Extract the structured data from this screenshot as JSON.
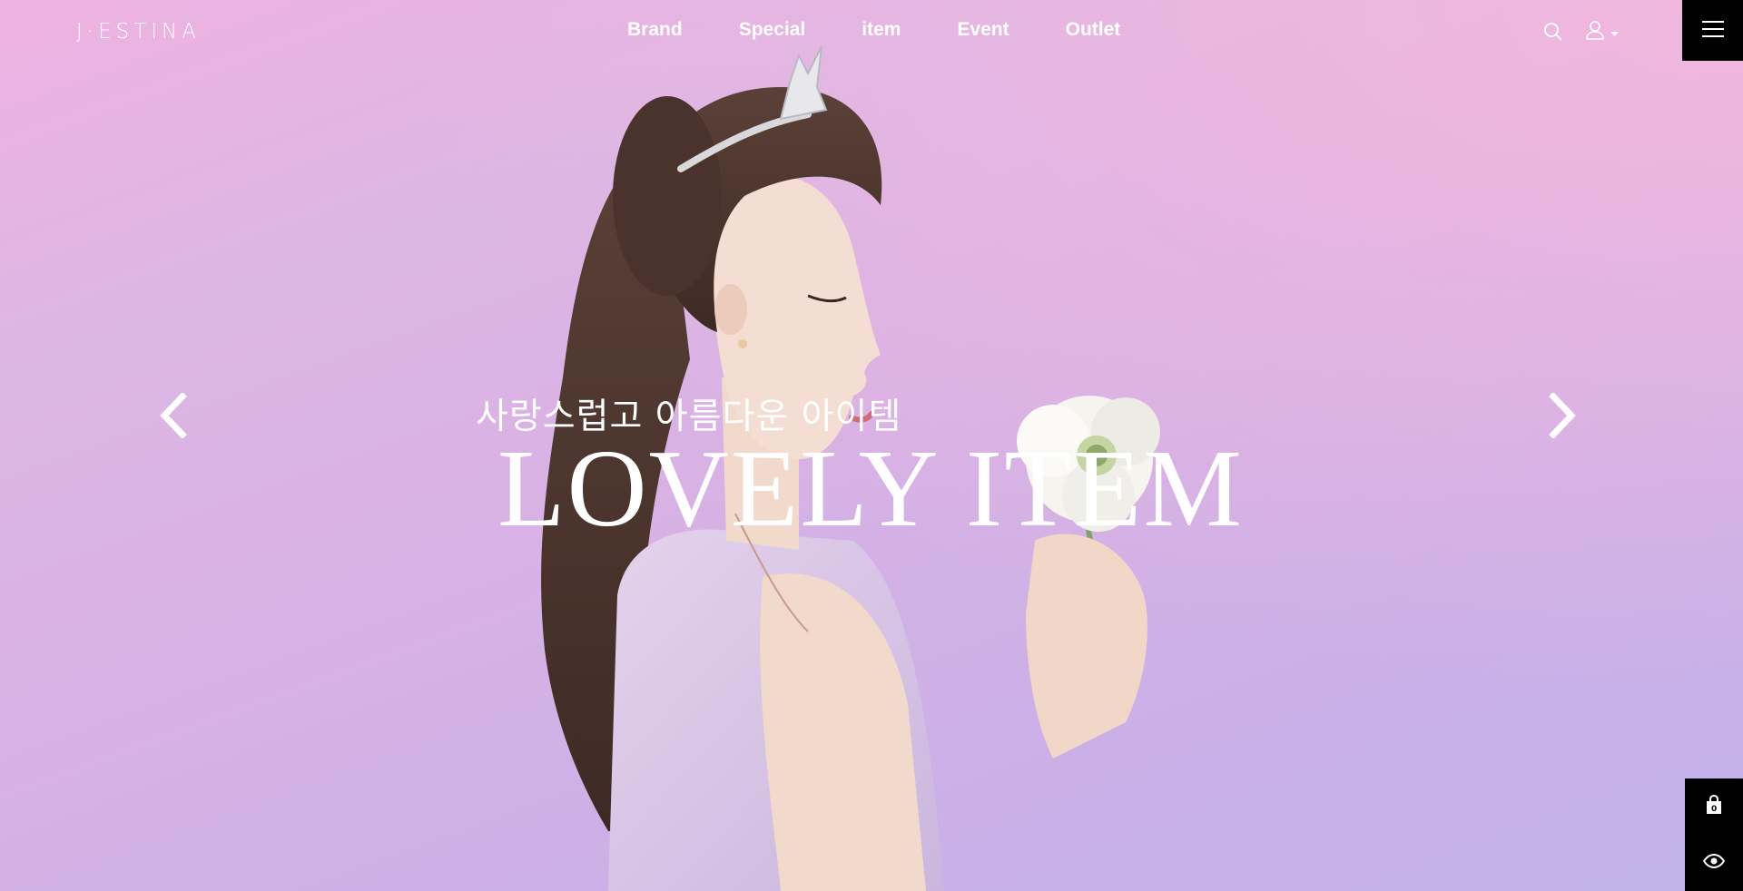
{
  "header": {
    "logo": "J·ESTINA",
    "nav": [
      "Brand",
      "Special",
      "item",
      "Event",
      "Outlet"
    ],
    "icons": [
      "search-icon",
      "user-icon",
      "chevron-down-icon",
      "hamburger-menu-icon"
    ]
  },
  "slider": {
    "subtitle": "사랑스럽고 아름다운 아이템",
    "title": "LOVELY ITEM",
    "prev_icon": "chevron-left-icon",
    "next_icon": "chevron-right-icon"
  },
  "quick_menu": {
    "cart_count": "0",
    "icons": [
      "shopping-bag-icon",
      "eye-icon"
    ]
  },
  "colors": {
    "background_top": "#efb2e0",
    "background_bottom": "#c2b2ea",
    "menu_button": "#000000",
    "text": "#ffffff"
  }
}
